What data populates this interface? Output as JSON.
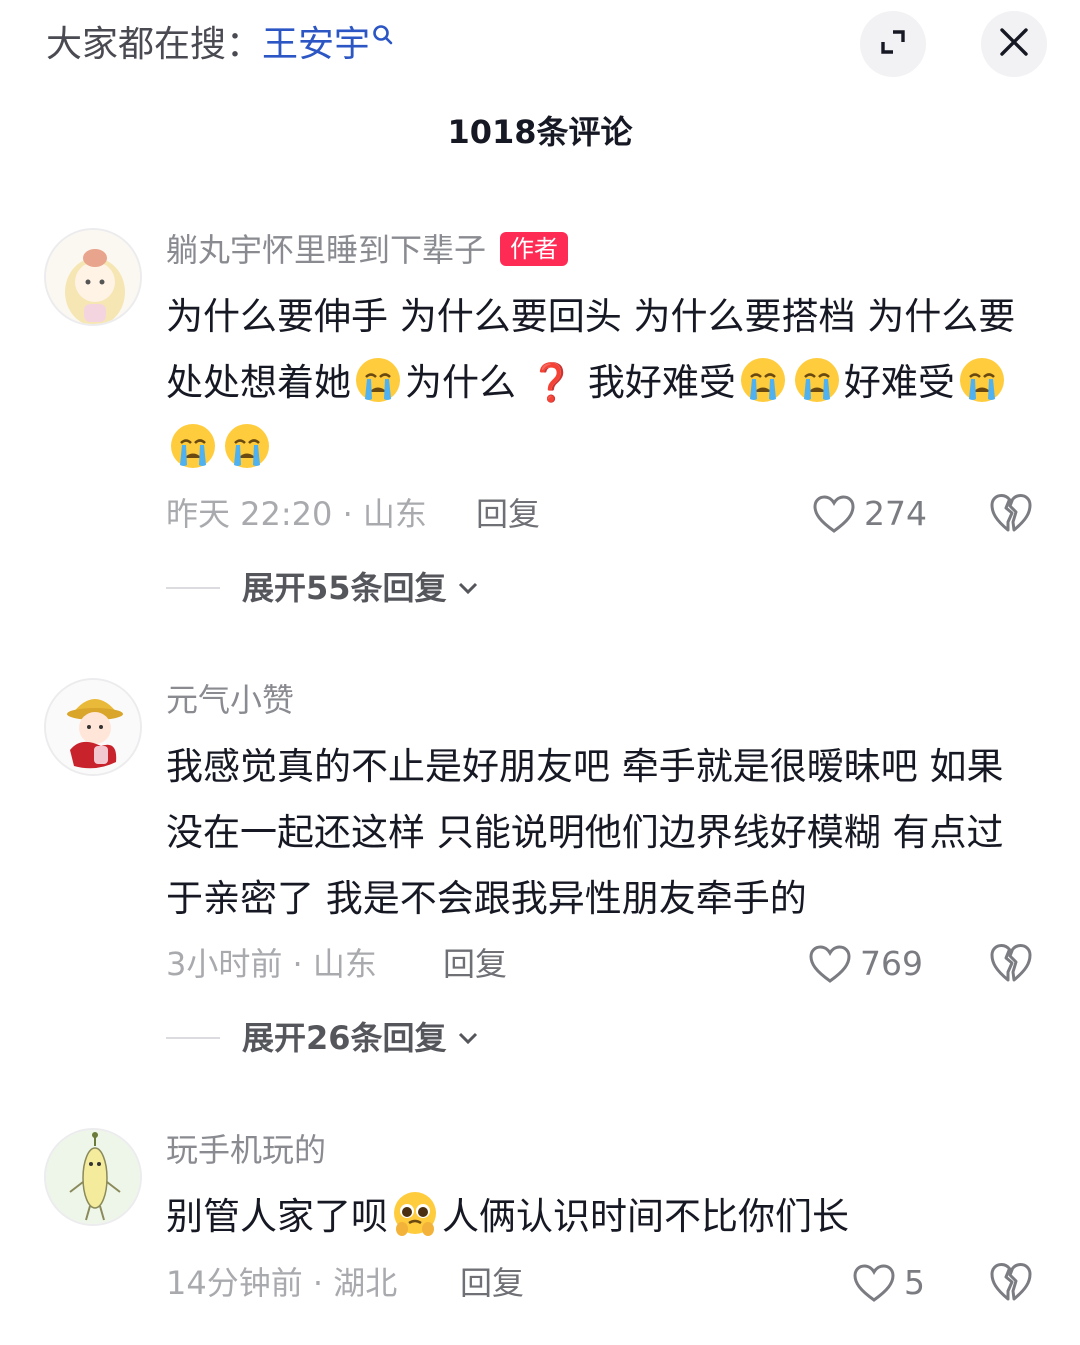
{
  "header": {
    "search_prefix": "大家都在搜：",
    "search_keyword": "王安宇",
    "expand_label": "expand",
    "close_label": "close"
  },
  "comment_count_title": "1018条评论",
  "comments": [
    {
      "username": "躺丸宇怀里睡到下辈子",
      "badge": "作者",
      "text_1": "为什么要伸手 为什么要回头 为什么要搭档 为什么要处处想着她",
      "text_2": "为什么",
      "text_3": "我好难受",
      "text_4": "好难受",
      "time_location": "昨天 22:20 · 山东",
      "reply_label": "回复",
      "likes": "274",
      "expand_label": "展开55条回复"
    },
    {
      "username": "元气小赞",
      "text": "我感觉真的不止是好朋友吧 牵手就是很暧昧吧 如果没在一起还这样 只能说明他们边界线好模糊 有点过于亲密了 我是不会跟我异性朋友牵手的",
      "time_location": "3小时前 · 山东",
      "reply_label": "回复",
      "likes": "769",
      "expand_label": "展开26条回复"
    },
    {
      "username": "玩手机玩的",
      "text_1": "别管人家了呗",
      "text_2": "人俩认识时间不比你们长",
      "time_location": "14分钟前 · 湖北",
      "reply_label": "回复",
      "likes": "5"
    }
  ],
  "colors": {
    "accent_link": "#2b56c4",
    "badge_red": "#fe2c55",
    "text_primary": "#161823",
    "text_secondary": "#a9aaae"
  },
  "icons": [
    "search-icon",
    "expand-icon",
    "close-icon",
    "heart-icon",
    "broken-heart-icon",
    "chevron-down-icon",
    "crying-emoji-icon",
    "pleading-emoji-icon",
    "red-question-icon"
  ]
}
